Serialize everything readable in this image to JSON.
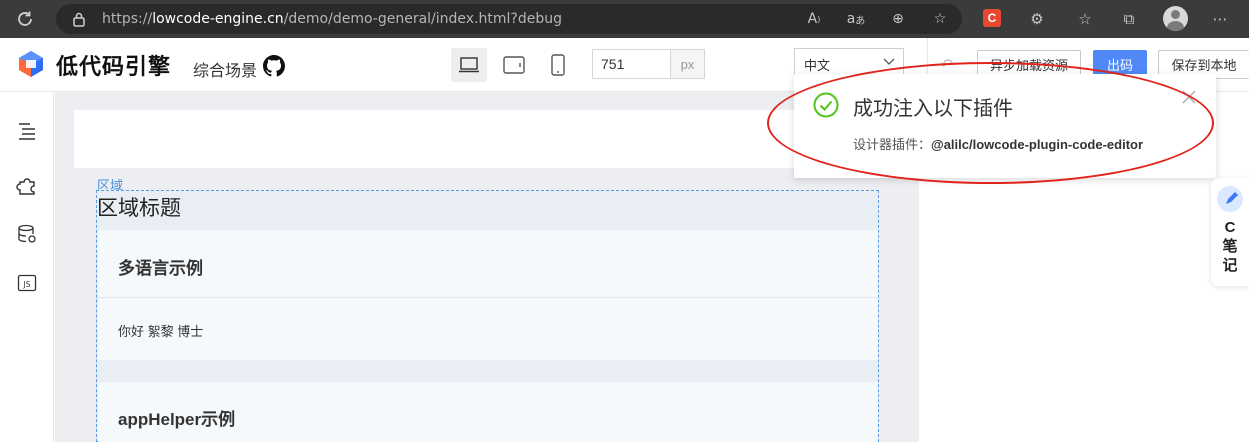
{
  "browser": {
    "url_prefix": "https://",
    "url_host": "lowcode-engine.cn",
    "url_path": "/demo/demo-general/index.html?debug",
    "ext_label": "C"
  },
  "app": {
    "logo_text": "低代码引擎",
    "scene_label": "综合场景",
    "canvas_width_value": "751",
    "canvas_width_unit": "px",
    "locale": "中文",
    "buttons": {
      "async_load": "异步加载资源",
      "export_code": "出码",
      "save_local": "保存到本地"
    }
  },
  "canvas": {
    "region_label": "区域",
    "region_title": "区域标题",
    "card1_title": "多语言示例",
    "card1_body": "你好 絮黎 博士",
    "card2_title": "appHelper示例"
  },
  "notification": {
    "title": "成功注入以下插件",
    "desc_prefix": "设计器插件：",
    "desc_plugin": "@alilc/lowcode-plugin-code-editor"
  },
  "side_widget": {
    "text_c": "C",
    "text_1": "笔",
    "text_2": "记"
  },
  "colors": {
    "primary": "#4f88f7",
    "success": "#52c41a",
    "annotation": "#e0241b",
    "region_border": "#5b9de5"
  }
}
